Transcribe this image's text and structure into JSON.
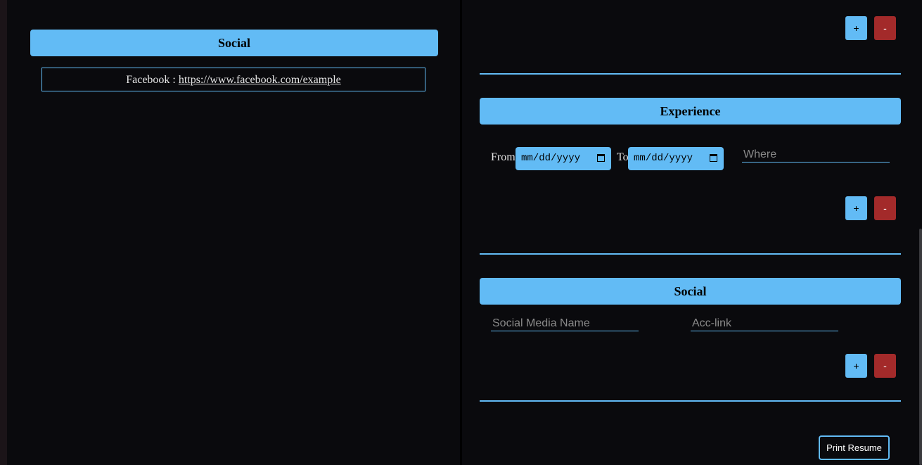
{
  "preview": {
    "social": {
      "header": "Social",
      "entry_name": "Facebook",
      "separator": " : ",
      "entry_link": "https://www.facebook.com/example"
    }
  },
  "editor": {
    "top_controls": {
      "add_label": "+",
      "remove_label": "-"
    },
    "experience": {
      "header": "Experience",
      "from_label": "From",
      "from_value": "mm/dd/yyyy",
      "to_label": "To",
      "to_value": "mm/dd/yyyy",
      "where_placeholder": "Where",
      "add_label": "+",
      "remove_label": "-"
    },
    "social": {
      "header": "Social",
      "name_placeholder": "Social Media Name",
      "link_placeholder": "Acc-link",
      "add_label": "+",
      "remove_label": "-"
    },
    "print_label": "Print Resume"
  },
  "colors": {
    "accent": "#62bbf5",
    "danger": "#a32a2a",
    "background": "#0a0a0d"
  }
}
